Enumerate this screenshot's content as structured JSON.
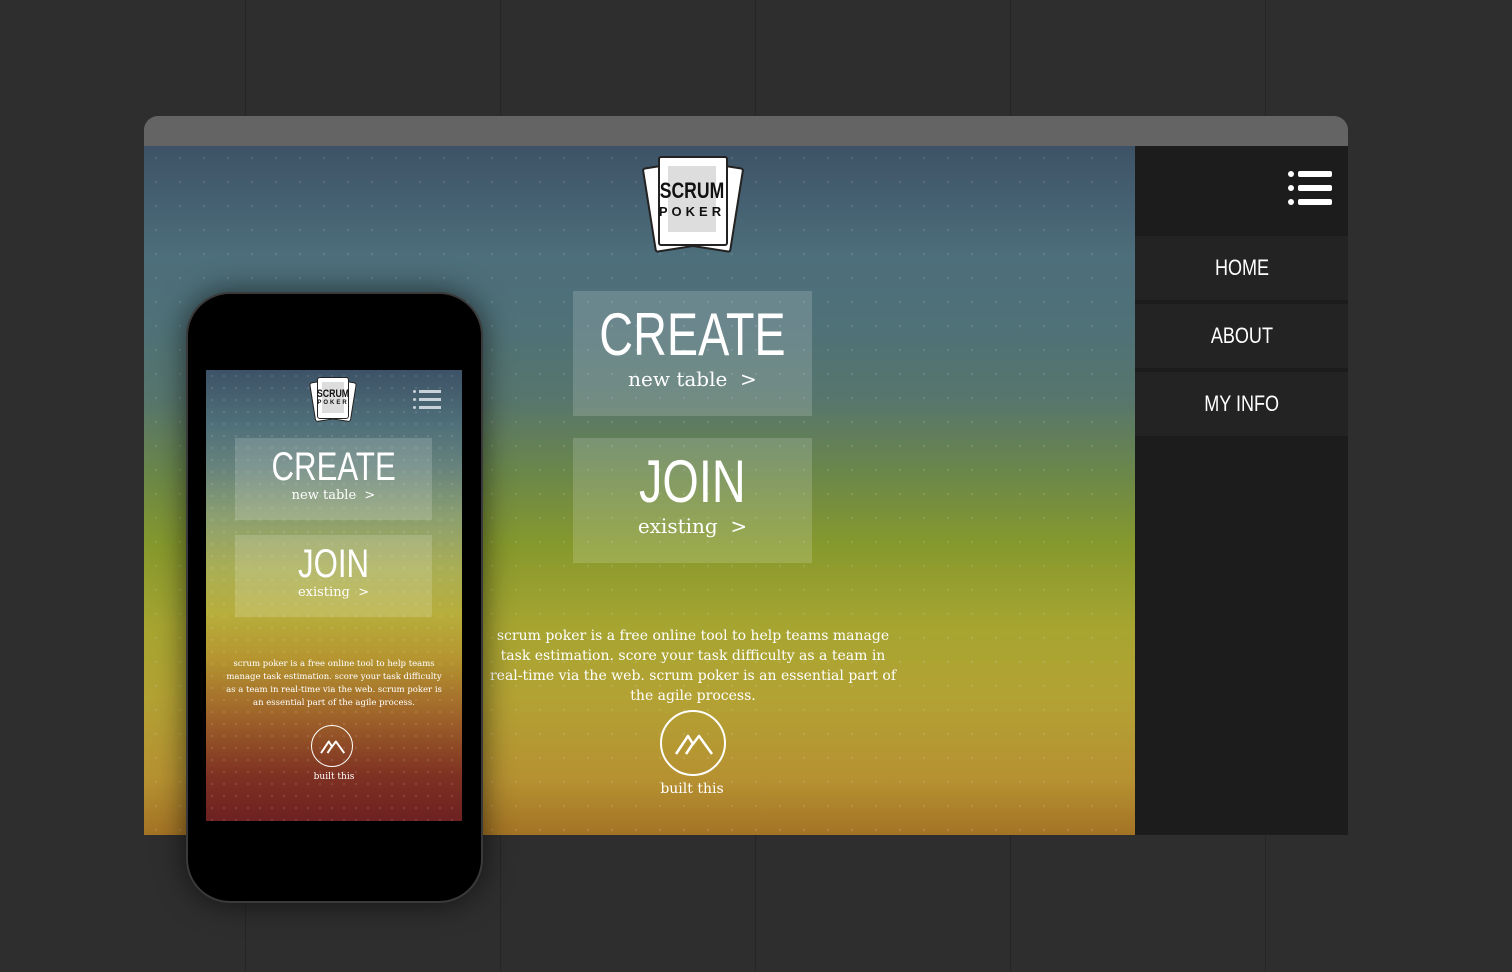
{
  "desktop": {
    "logo": {
      "line1": "SCRUM",
      "line2": "POKER"
    },
    "create": {
      "title": "CREATE",
      "subtitle": "new table  >"
    },
    "join": {
      "title": "JOIN",
      "subtitle": "existing  >"
    },
    "description": "scrum poker is a free online tool to help teams manage task estimation. score your task difficulty as a team in real-time via the web. scrum poker is an essential part of the agile process.",
    "built_label": "built this",
    "brand_icon": "mountain-logo-icon"
  },
  "sidenav": {
    "menu_icon": "hamburger-menu-icon",
    "items": [
      {
        "label": "HOME"
      },
      {
        "label": "ABOUT"
      },
      {
        "label": "MY INFO"
      }
    ]
  },
  "mobile": {
    "logo": {
      "line1": "SCRUM",
      "line2": "POKER"
    },
    "menu_icon": "hamburger-menu-icon",
    "create": {
      "title": "CREATE",
      "subtitle": "new table  >"
    },
    "join": {
      "title": "JOIN",
      "subtitle": "existing  >"
    },
    "description": "scrum poker is a free online tool to help teams manage task estimation. score your task difficulty as a team in real-time via the web. scrum poker is an essential part of the agile process.",
    "built_label": "built this",
    "brand_icon": "mountain-logo-icon"
  },
  "colors": {
    "page_background": "#2e2e2e",
    "titlebar": "#646464",
    "sidenav": "#1c1c1c",
    "nav_item": "#232323",
    "gradient_top": "#3d5266",
    "gradient_mid": "#86992d",
    "gradient_bottom": "#a37325"
  }
}
